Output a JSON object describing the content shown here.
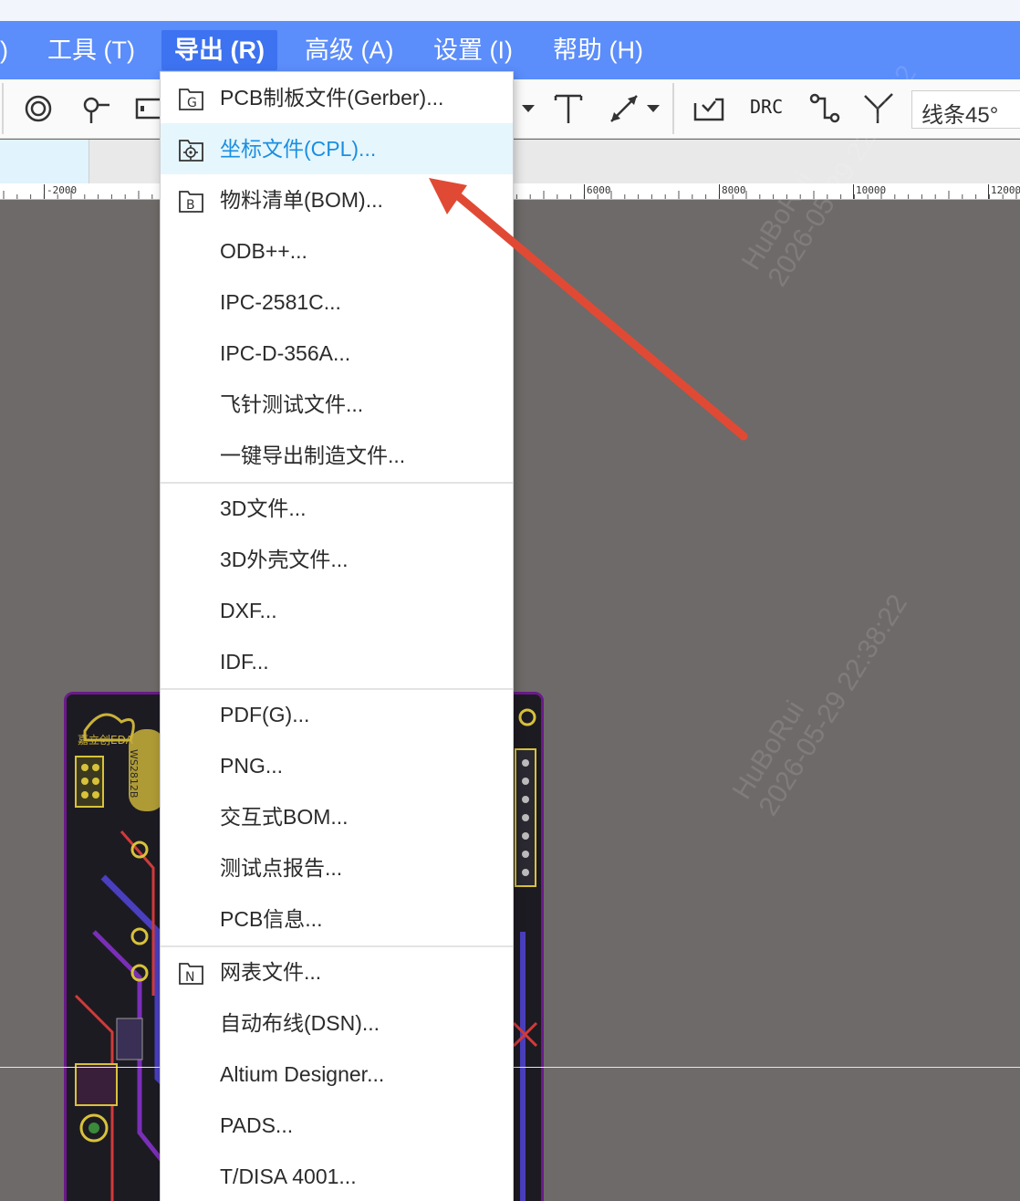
{
  "menubar": {
    "partial_left": ")",
    "items": [
      {
        "label": "工具 (T)"
      },
      {
        "label": "导出 (R)"
      },
      {
        "label": "高级 (A)"
      },
      {
        "label": "设置 (I)"
      },
      {
        "label": "帮助 (H)"
      }
    ]
  },
  "toolbar": {
    "drc_label": "DRC",
    "line_mode": "线条45°"
  },
  "ruler": {
    "labels": [
      "-2000",
      "6000",
      "8000",
      "10000",
      "12000"
    ]
  },
  "export_menu": {
    "items": [
      {
        "label": "PCB制板文件(Gerber)...",
        "icon_letter": "G"
      },
      {
        "label": "坐标文件(CPL)..."
      },
      {
        "label": "物料清单(BOM)...",
        "icon_letter": "B"
      },
      {
        "label": "ODB++..."
      },
      {
        "label": "IPC-2581C..."
      },
      {
        "label": "IPC-D-356A..."
      },
      {
        "label": "飞针测试文件..."
      },
      {
        "label": "一键导出制造文件..."
      },
      {
        "label": "3D文件..."
      },
      {
        "label": "3D外壳文件..."
      },
      {
        "label": "DXF..."
      },
      {
        "label": "IDF..."
      },
      {
        "label": "PDF(G)..."
      },
      {
        "label": "PNG..."
      },
      {
        "label": "交互式BOM..."
      },
      {
        "label": "测试点报告..."
      },
      {
        "label": "PCB信息..."
      },
      {
        "label": "网表文件...",
        "icon_letter": "N"
      },
      {
        "label": "自动布线(DSN)..."
      },
      {
        "label": "Altium Designer..."
      },
      {
        "label": "PADS..."
      },
      {
        "label": "T/DISA 4001..."
      }
    ]
  },
  "watermark": {
    "name": "HuBoRui",
    "date": "2026-05-29 22:38:22"
  },
  "pcb_text": {
    "logo": "嘉立创EDA",
    "chip": "WS2812B"
  },
  "colors": {
    "menubar": "#5b8dfb",
    "active_menu": "#3d72f0",
    "highlight_bg": "#e6f6fd",
    "highlight_text": "#1a8fe0",
    "arrow": "#e04a35",
    "canvas": "#6e6a69"
  }
}
